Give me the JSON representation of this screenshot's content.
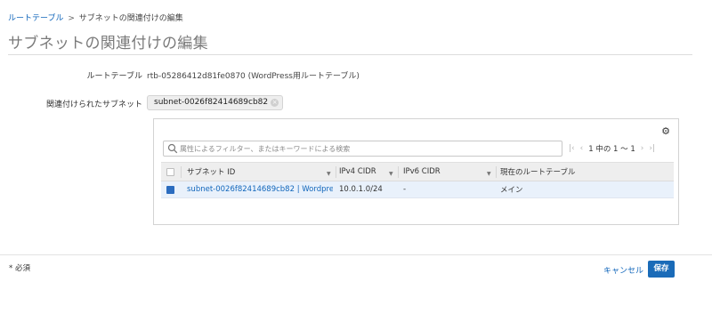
{
  "breadcrumb": {
    "parent": "ルートテーブル",
    "separator": ">",
    "current": "サブネットの関連付けの編集"
  },
  "page_title": "サブネットの関連付けの編集",
  "form": {
    "route_table_label": "ルートテーブル",
    "route_table_value": "rtb-05286412d81fe0870 (WordPress用ルートテーブル)",
    "associated_subnets_label": "関連付けられたサブネット",
    "selected_subnet_token": "subnet-0026f82414689cb82"
  },
  "table": {
    "search_placeholder": "属性によるフィルター、またはキーワードによる検索",
    "pagination": "1 中の 1 〜 1",
    "columns": [
      "サブネット ID",
      "IPv4 CIDR",
      "IPv6 CIDR",
      "現在のルートテーブル"
    ],
    "rows": [
      {
        "checked": true,
        "subnet_id": "subnet-0026f82414689cb82 | Wordpress…",
        "ipv4_cidr": "10.0.1.0/24",
        "ipv6_cidr": "-",
        "current_route_table": "メイン"
      }
    ]
  },
  "footer": {
    "required_note": "* 必須",
    "cancel_label": "キャンセル",
    "save_label": "保存"
  },
  "icons": {
    "settings": "gear-icon",
    "search": "search-icon",
    "token_remove": "close-circle-icon"
  },
  "colors": {
    "link": "#1166bb",
    "primary_button": "#1a6bb8",
    "selected_row": "#e9f1fb"
  }
}
